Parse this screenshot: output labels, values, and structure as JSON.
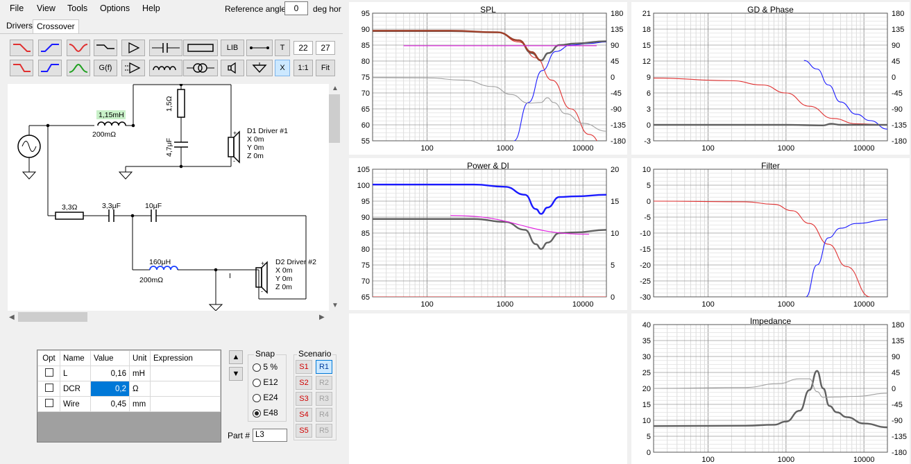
{
  "menu": [
    "File",
    "View",
    "Tools",
    "Options",
    "Help"
  ],
  "reference": {
    "label": "Reference angle",
    "value": "0",
    "unit": "deg hor"
  },
  "tabs": [
    "Drivers",
    "Crossover"
  ],
  "toolbar": {
    "lib": "LIB",
    "t": "T",
    "gf": "G(f)",
    "x": "X",
    "one_to_one": "1:1",
    "fit": "Fit",
    "num1": "22",
    "num2": "27"
  },
  "schematic": {
    "l1_value": "1,15mH",
    "l1_dcr": "200mΩ",
    "r1_value": "1,5Ω",
    "c1_value": "4,7μF",
    "d1_name": "D1 Driver #1",
    "d1_x": "X 0m",
    "d1_y": "Y 0m",
    "d1_z": "Z 0m",
    "r2_value": "3,3Ω",
    "c2_value": "3,3μF",
    "c3_value": "10μF",
    "l2_value": "160μH",
    "l2_dcr": "200mΩ",
    "d2_name": "D2 Driver #2",
    "d2_x": "X 0m",
    "d2_y": "Y 0m",
    "d2_z": "Z 0m",
    "cursor": "I"
  },
  "param_table": {
    "headers": [
      "Opt",
      "Name",
      "Value",
      "Unit",
      "Expression"
    ],
    "rows": [
      {
        "name": "L",
        "value": "0,16",
        "unit": "mH",
        "expr": ""
      },
      {
        "name": "DCR",
        "value": "0,2",
        "unit": "Ω",
        "expr": ""
      },
      {
        "name": "Wire",
        "value": "0,45",
        "unit": "mm",
        "expr": ""
      }
    ]
  },
  "snap": {
    "title": "Snap",
    "options": [
      "5 %",
      "E12",
      "E24",
      "E48"
    ],
    "selected": "E48"
  },
  "scenario": {
    "title": "Scenario",
    "s": [
      "S1",
      "S2",
      "S3",
      "S4",
      "S5"
    ],
    "r": [
      "R1",
      "R2",
      "R3",
      "R4",
      "R5"
    ],
    "active_r": "R1"
  },
  "part": {
    "label": "Part #",
    "value": "L3"
  },
  "colors": {
    "red": "#e03030",
    "blue": "#1a1aff",
    "gray": "#a0a0a0",
    "darkgray": "#606060",
    "magenta": "#e020e0",
    "brown": "#a0402a"
  },
  "chart_data": [
    {
      "type": "line",
      "title": "SPL",
      "xscale": "log",
      "xlim": [
        20,
        20000
      ],
      "xticks": [
        "100",
        "1000",
        "10000"
      ],
      "ylim": [
        55,
        95
      ],
      "yticks_left": [
        "95",
        "90",
        "85",
        "80",
        "75",
        "70",
        "65",
        "60",
        "55"
      ],
      "yticks_right": [
        "180",
        "135",
        "90",
        "45",
        "0",
        "-45",
        "-90",
        "-135",
        "-180"
      ],
      "grid": true,
      "series": [
        {
          "color": "red",
          "x": [
            20,
            200,
            800,
            1500,
            2500,
            4000,
            7000,
            12000,
            20000
          ],
          "y": [
            89.5,
            89.5,
            89,
            86,
            81,
            74,
            65,
            57,
            52
          ]
        },
        {
          "color": "blue",
          "x": [
            1300,
            2000,
            3000,
            4500,
            7000,
            12000,
            20000
          ],
          "y": [
            55,
            67,
            77,
            83,
            85,
            85.5,
            86
          ]
        },
        {
          "color": "darkgray",
          "x": [
            20,
            200,
            800,
            1500,
            2200,
            2900,
            3600,
            5000,
            8000,
            20000
          ],
          "y": [
            89.4,
            89.4,
            89,
            86.5,
            82.5,
            80.2,
            82.5,
            85,
            85.5,
            86.2
          ]
        },
        {
          "color": "brown",
          "x": [
            20,
            200,
            800,
            1500,
            2200,
            2900
          ],
          "y": [
            89.5,
            89.5,
            89,
            86.5,
            82.8,
            80.2
          ]
        },
        {
          "color": "gray",
          "x": [
            20,
            100,
            300,
            700,
            1200,
            2000,
            2900,
            3500,
            4200,
            6000,
            10000,
            20000
          ],
          "y": [
            74.8,
            74.7,
            74,
            72,
            69.5,
            66.8,
            67,
            68.5,
            67,
            63.5,
            60.5,
            58
          ]
        },
        {
          "color": "magenta",
          "x": [
            50,
            15000
          ],
          "y": [
            84.8,
            84.8
          ]
        }
      ]
    },
    {
      "type": "line",
      "title": "GD & Phase",
      "xscale": "log",
      "xlim": [
        20,
        20000
      ],
      "xticks": [
        "100",
        "1000",
        "10000"
      ],
      "ylim": [
        -3,
        21
      ],
      "yticks_left": [
        "21",
        "18",
        "15",
        "12",
        "9",
        "6",
        "3",
        "0",
        "-3"
      ],
      "yticks_right": [
        "180",
        "135",
        "90",
        "45",
        "0",
        "-45",
        "-90",
        "-135",
        "-180"
      ],
      "grid": true,
      "series": [
        {
          "color": "red",
          "x": [
            20,
            200,
            500,
            1000,
            2000,
            4000,
            8000,
            20000
          ],
          "y": [
            8.8,
            8.3,
            7.5,
            6,
            3.5,
            1.2,
            0.2,
            0
          ]
        },
        {
          "color": "blue",
          "x": [
            1700,
            2500,
            3500,
            5000,
            8000,
            12000,
            20000
          ],
          "y": [
            12.1,
            10.5,
            7.5,
            4.3,
            2,
            0.8,
            -0.8
          ]
        },
        {
          "color": "darkgray",
          "x": [
            20,
            1000,
            3000,
            3800,
            5000,
            20000
          ],
          "y": [
            0,
            0,
            -0.1,
            0.2,
            0,
            0
          ]
        }
      ]
    },
    {
      "type": "line",
      "title": "Power & DI",
      "xscale": "log",
      "xlim": [
        20,
        20000
      ],
      "xticks": [
        "100",
        "1000",
        "10000"
      ],
      "ylim": [
        65,
        105
      ],
      "yticks_left": [
        "105",
        "100",
        "95",
        "90",
        "85",
        "80",
        "75",
        "70",
        "65"
      ],
      "yticks_right": [
        "20",
        "15",
        "10",
        "5",
        "0"
      ],
      "grid": true,
      "series": [
        {
          "color": "blue",
          "x": [
            20,
            400,
            1000,
            1800,
            2500,
            2900,
            3500,
            5000,
            8000,
            20000
          ],
          "y": [
            100.2,
            100.2,
            99.5,
            97,
            92.5,
            91,
            93,
            96.3,
            96.5,
            97
          ]
        },
        {
          "color": "darkgray",
          "x": [
            20,
            400,
            1000,
            1800,
            2500,
            2900,
            3500,
            5000,
            8000,
            20000
          ],
          "y": [
            89.4,
            89.4,
            88.5,
            86,
            81.5,
            80,
            82,
            85,
            85.2,
            86
          ]
        },
        {
          "color": "magenta",
          "x": [
            200,
            12000
          ],
          "y": [
            90.5,
            84.6
          ]
        },
        {
          "color": "red",
          "x": [
            20,
            20000
          ],
          "y": [
            65,
            65
          ]
        }
      ]
    },
    {
      "type": "line",
      "title": "Filter",
      "xscale": "log",
      "xlim": [
        20,
        20000
      ],
      "xticks": [
        "100",
        "1000",
        "10000"
      ],
      "ylim": [
        -30,
        10
      ],
      "yticks_left": [
        "10",
        "5",
        "0",
        "-5",
        "-10",
        "-15",
        "-20",
        "-25",
        "-30"
      ],
      "grid": true,
      "series": [
        {
          "color": "red",
          "x": [
            20,
            300,
            700,
            1200,
            2000,
            3500,
            6000,
            12000
          ],
          "y": [
            0,
            -0.2,
            -1,
            -3,
            -7,
            -13.5,
            -20.5,
            -30
          ]
        },
        {
          "color": "blue",
          "x": [
            1800,
            2500,
            3500,
            5000,
            8000,
            20000
          ],
          "y": [
            -30,
            -20,
            -11.5,
            -8.5,
            -7,
            -5.8
          ]
        }
      ]
    },
    {
      "type": "line",
      "title": "Impedance",
      "xscale": "log",
      "xlim": [
        20,
        20000
      ],
      "xticks": [
        "100",
        "1000",
        "10000"
      ],
      "ylim": [
        0,
        40
      ],
      "yticks_left": [
        "40",
        "35",
        "30",
        "25",
        "20",
        "15",
        "10",
        "5",
        "0"
      ],
      "yticks_right": [
        "180",
        "135",
        "90",
        "45",
        "0",
        "-45",
        "-90",
        "-135",
        "-180"
      ],
      "grid": true,
      "series": [
        {
          "color": "darkgray",
          "x": [
            20,
            300,
            700,
            1000,
            1500,
            2000,
            2500,
            3000,
            3600,
            4500,
            6000,
            10000,
            20000
          ],
          "y": [
            8.2,
            8.3,
            8.6,
            9.6,
            13,
            19.5,
            25.5,
            20,
            14.5,
            12.5,
            11,
            9,
            7.8
          ]
        },
        {
          "color": "gray",
          "x": [
            20,
            300,
            800,
            1500,
            2000,
            2500,
            3000,
            4000,
            8000,
            20000
          ],
          "y": [
            20,
            20.3,
            21.5,
            23,
            23,
            19,
            17.2,
            17.3,
            17.5,
            18.5
          ]
        }
      ]
    }
  ]
}
